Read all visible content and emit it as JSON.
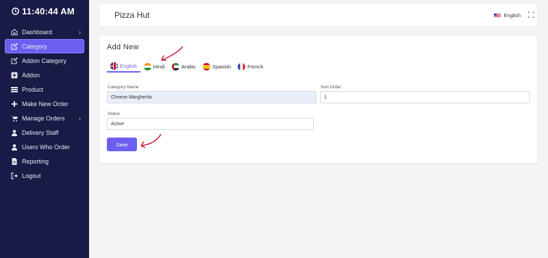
{
  "clock": "11:40:44 AM",
  "sidebar": {
    "items": [
      {
        "label": "Dashboard",
        "icon": "home-icon"
      },
      {
        "label": "Category",
        "icon": "edit-icon"
      },
      {
        "label": "Addon Category",
        "icon": "edit-icon"
      },
      {
        "label": "Addon",
        "icon": "plus-square-icon"
      },
      {
        "label": "Product",
        "icon": "list-icon"
      },
      {
        "label": "Make New Order",
        "icon": "plus-icon"
      },
      {
        "label": "Manage Orders",
        "icon": "cart-icon"
      },
      {
        "label": "Delivery Staff",
        "icon": "user-icon"
      },
      {
        "label": "Users Who Order",
        "icon": "users-icon"
      },
      {
        "label": "Reporting",
        "icon": "file-icon"
      },
      {
        "label": "Logout",
        "icon": "logout-icon"
      }
    ],
    "active_index": 1
  },
  "topbar": {
    "brand": "Pizza Hut",
    "language": "English"
  },
  "form": {
    "title": "Add New",
    "tabs": [
      "English",
      "Hindi",
      "Arabic",
      "Spanish",
      "French"
    ],
    "active_tab": "English",
    "category_name_label": "Category Name",
    "category_name_value": "Cheese Margherita",
    "sort_order_label": "Sort Order",
    "sort_order_value": "1",
    "status_label": "Status",
    "status_value": "Active",
    "save_label": "Save"
  },
  "colors": {
    "sidebar_bg": "#171b45",
    "accent": "#6c5ff0",
    "annotation_arrow": "#c8102e"
  }
}
